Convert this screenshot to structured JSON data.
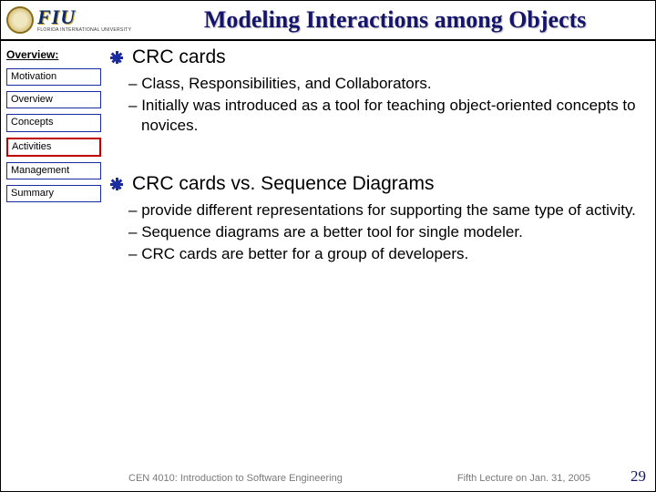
{
  "header": {
    "logo_text": "FIU",
    "logo_subtext": "Florida International University",
    "title": "Modeling Interactions among Objects"
  },
  "sidebar": {
    "heading": "Overview:",
    "items": [
      {
        "label": "Motivation",
        "active": false
      },
      {
        "label": "Overview",
        "active": false
      },
      {
        "label": "Concepts",
        "active": false
      },
      {
        "label": "Activities",
        "active": true
      },
      {
        "label": "Management",
        "active": false
      },
      {
        "label": "Summary",
        "active": false
      }
    ]
  },
  "content": {
    "bullets": [
      {
        "text": "CRC cards",
        "sub": [
          "Class, Responsibilities, and Collaborators.",
          "Initially was introduced as a tool for teaching object-oriented concepts to novices."
        ]
      },
      {
        "text": "CRC cards vs. Sequence Diagrams",
        "sub": [
          "provide different representations for supporting the same type of activity.",
          "Sequence diagrams are a better tool for single modeler.",
          "CRC cards are better for a group of developers."
        ]
      }
    ]
  },
  "footer": {
    "course": "CEN 4010: Introduction to Software Engineering",
    "lecture": "Fifth Lecture on Jan. 31, 2005",
    "page": "29"
  }
}
